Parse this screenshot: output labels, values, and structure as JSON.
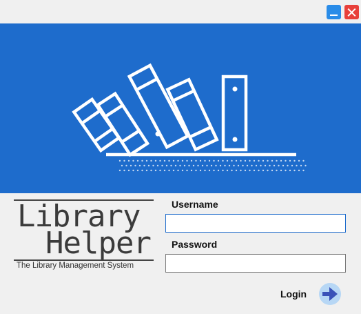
{
  "window": {
    "minimize_icon": "minimize-icon",
    "close_icon": "close-icon",
    "colors": {
      "minimize": "#2a8ce8",
      "close": "#e8403a"
    }
  },
  "banner": {
    "background": "#1e6ccc",
    "illustration": "books-on-shelf-icon"
  },
  "logo": {
    "line1": "Library",
    "line2": "Helper",
    "tagline": "The Library Management System"
  },
  "form": {
    "username_label": "Username",
    "username_value": "",
    "password_label": "Password",
    "password_value": "",
    "login_label": "Login",
    "login_icon": "arrow-right-icon"
  }
}
